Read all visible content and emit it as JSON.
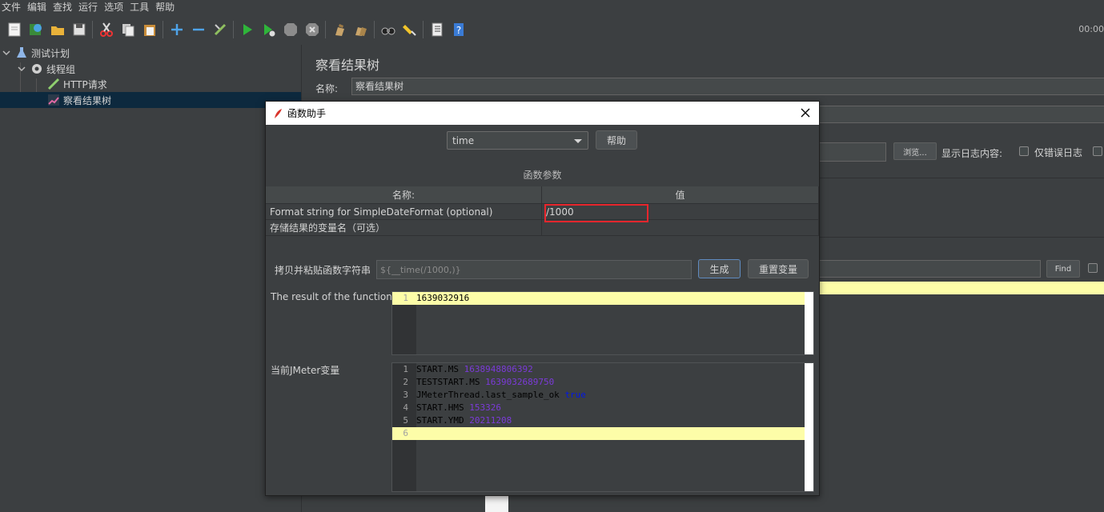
{
  "menu": [
    "文件",
    "编辑",
    "查找",
    "运行",
    "选项",
    "工具",
    "帮助"
  ],
  "toolbar": {
    "icons": [
      "new-icon",
      "templates-icon",
      "open-icon",
      "save-icon",
      "cut-icon",
      "copy-icon",
      "paste-icon",
      "add-icon",
      "remove-icon",
      "toggle-icon",
      "start-icon",
      "start-no-pause-icon",
      "stop-icon",
      "shutdown-icon",
      "clear-icon",
      "clear-all-icon",
      "search-icon",
      "reset-search-icon",
      "function-helper-icon",
      "help-icon"
    ],
    "clock": "00:00"
  },
  "tree": {
    "items": [
      {
        "label": "测试计划",
        "icon": "flask-icon"
      },
      {
        "label": "线程组",
        "icon": "gear-icon"
      },
      {
        "label": "HTTP请求",
        "icon": "pencil-icon"
      },
      {
        "label": "察看结果树",
        "icon": "chart-icon"
      }
    ]
  },
  "panel": {
    "title": "察看结果树",
    "name_label": "名称:",
    "name_value": "察看结果树",
    "browse": "浏览...",
    "log_label": "显示日志内容:",
    "errors_only": "仅错误日志",
    "find": "Find"
  },
  "dialog": {
    "title": "函数助手",
    "selected_function": "time",
    "help": "帮助",
    "params_title": "函数参数",
    "col_name": "名称:",
    "col_value": "值",
    "params": [
      {
        "name": "Format string for SimpleDateFormat (optional)",
        "value": "/1000"
      },
      {
        "name": "存储结果的变量名（可选）",
        "value": ""
      }
    ],
    "copy_label": "拷贝并粘贴函数字符串",
    "function_string": "${__time(/1000,)}",
    "generate": "生成",
    "reset": "重置变量",
    "result_label": "The result of the function is",
    "result_lines": [
      {
        "n": "1",
        "value": "1639032916"
      }
    ],
    "vars_label": "当前JMeter变量",
    "vars_lines": [
      {
        "n": "1",
        "key": "START.MS",
        "value": "1638948806392"
      },
      {
        "n": "2",
        "key": "TESTSTART.MS",
        "value": "1639032689750"
      },
      {
        "n": "3",
        "key": "JMeterThread.last_sample_ok",
        "value": "true"
      },
      {
        "n": "4",
        "key": "START.HMS",
        "value": "153326"
      },
      {
        "n": "5",
        "key": "START.YMD",
        "value": "20211208"
      },
      {
        "n": "6",
        "key": "",
        "value": ""
      }
    ]
  },
  "colors": {
    "background": "#3c3f41",
    "selection": "#0d293e",
    "highlight_line": "#fdfda8",
    "annotation_box": "#e8262d",
    "number_purple": "#7b3ad8",
    "keyword_blue": "#0017e6"
  }
}
